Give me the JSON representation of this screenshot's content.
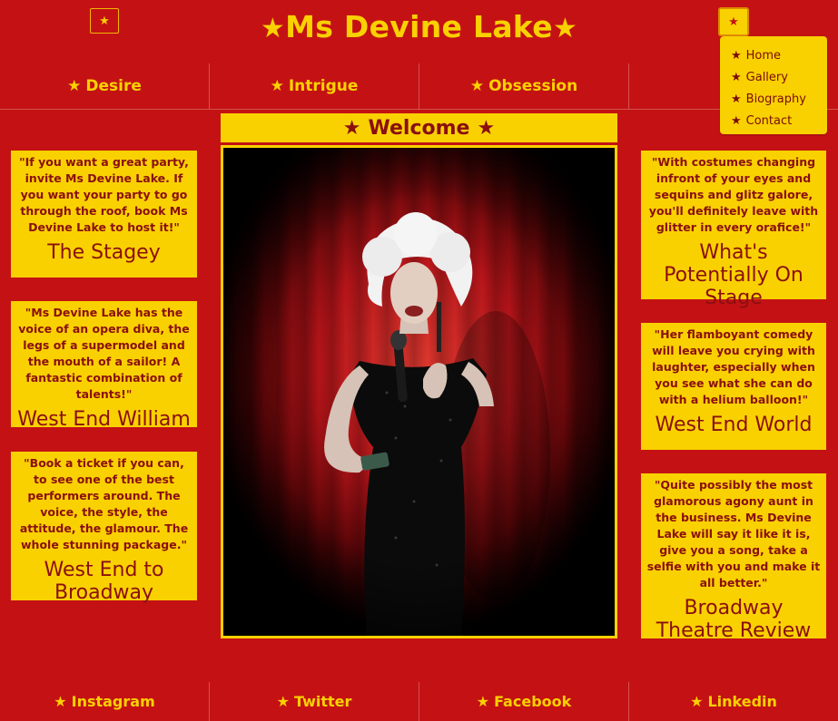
{
  "header": {
    "title": "Ms Devine Lake",
    "left_icon": "star-icon",
    "menu_icon": "star-icon"
  },
  "nav": {
    "items": [
      {
        "label": "Desire"
      },
      {
        "label": "Intrigue"
      },
      {
        "label": "Obsession"
      },
      {
        "label": ""
      }
    ]
  },
  "dropdown": {
    "items": [
      {
        "label": "Home"
      },
      {
        "label": "Gallery"
      },
      {
        "label": "Biography"
      },
      {
        "label": "Contact"
      }
    ]
  },
  "main": {
    "welcome": "Welcome",
    "hero_alt": "Performer in black sequin gown singing into microphone on stage with red curtain and spotlight"
  },
  "reviews": {
    "left": [
      {
        "quote": "\"If you want a great party, invite Ms Devine Lake. If you want your party to go through the roof, book Ms Devine Lake to host it!\"",
        "source": "The Stagey"
      },
      {
        "quote": "\"Ms Devine Lake has the voice of an opera diva, the legs of a supermodel and the mouth of a sailor! A fantastic combination of talents!\"",
        "source": "West End William"
      },
      {
        "quote": "\"Book a ticket if you can, to see one of the best performers around. The voice, the style, the attitude, the glamour. The whole stunning package.\"",
        "source": "West End to Broadway"
      }
    ],
    "right": [
      {
        "quote": "\"With costumes changing infront of your eyes and sequins and glitz galore, you'll definitely leave with glitter in every orafice!\"",
        "source": "What's Potentially On Stage"
      },
      {
        "quote": "\"Her flamboyant comedy will leave you crying with laughter, especially when you see what she can do with a helium balloon!\"",
        "source": "West End World"
      },
      {
        "quote": "\"Quite possibly the most glamorous agony aunt in the business. Ms Devine Lake will say it like it is, give you a song, take a selfie with you and make it all better.\"",
        "source": "Broadway Theatre Review"
      }
    ]
  },
  "footer": {
    "items": [
      {
        "label": "Instagram"
      },
      {
        "label": "Twitter"
      },
      {
        "label": "Facebook"
      },
      {
        "label": "Linkedin"
      }
    ]
  },
  "colors": {
    "background": "#c41214",
    "accent": "#f9d100",
    "text_dark": "#8a0f0f"
  }
}
